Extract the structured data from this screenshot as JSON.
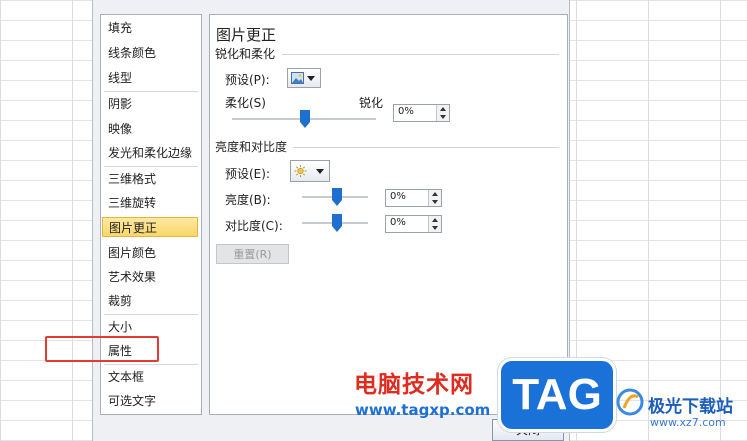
{
  "categories": [
    "填充",
    "线条颜色",
    "线型",
    "阴影",
    "映像",
    "发光和柔化边缘",
    "三维格式",
    "三维旋转",
    "图片更正",
    "图片颜色",
    "艺术效果",
    "裁剪",
    "大小",
    "属性",
    "文本框",
    "可选文字"
  ],
  "selected_category": "图片更正",
  "panel": {
    "title": "图片更正",
    "sharpen_section": "锐化和柔化",
    "preset_label": "预设(P):",
    "soften_label": "柔化(S)",
    "sharpen_label": "锐化",
    "sharpen_value": "0%",
    "brightness_section": "亮度和对比度",
    "preset2_label": "预设(E):",
    "brightness_label": "亮度(B):",
    "brightness_value": "0%",
    "contrast_label": "对比度(C):",
    "contrast_value": "0%",
    "reset_label": "重置(R)"
  },
  "close_label": "关闭",
  "watermark": {
    "site_name": "电脑技术网",
    "site_url": "www.tagxp.com",
    "tag_logo": "TAG",
    "xz_name": "极光下载站",
    "xz_url": "www.xz7.com"
  },
  "colors": {
    "selected_bg": "#f9d76a",
    "slider_thumb": "#1f6fcf",
    "highlight_box": "#e33b32",
    "watermark_red": "#e02b1f",
    "watermark_blue": "#1e6fd6"
  }
}
